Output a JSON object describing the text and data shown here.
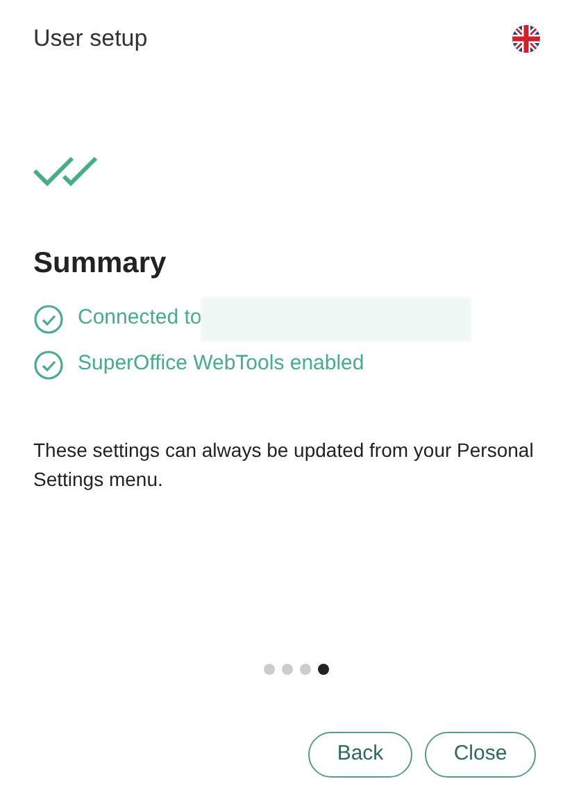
{
  "window": {
    "title": "User setup"
  },
  "heading": "Summary",
  "status_items": [
    {
      "text": "Connected to",
      "redacted": true
    },
    {
      "text": "SuperOffice WebTools enabled",
      "redacted": false
    }
  ],
  "note": "These settings can always be updated from your Personal Settings menu.",
  "steps": [
    {
      "selected": false
    },
    {
      "selected": false
    },
    {
      "selected": false
    },
    {
      "selected": true
    }
  ],
  "buttons": [
    "Back",
    "Close"
  ]
}
